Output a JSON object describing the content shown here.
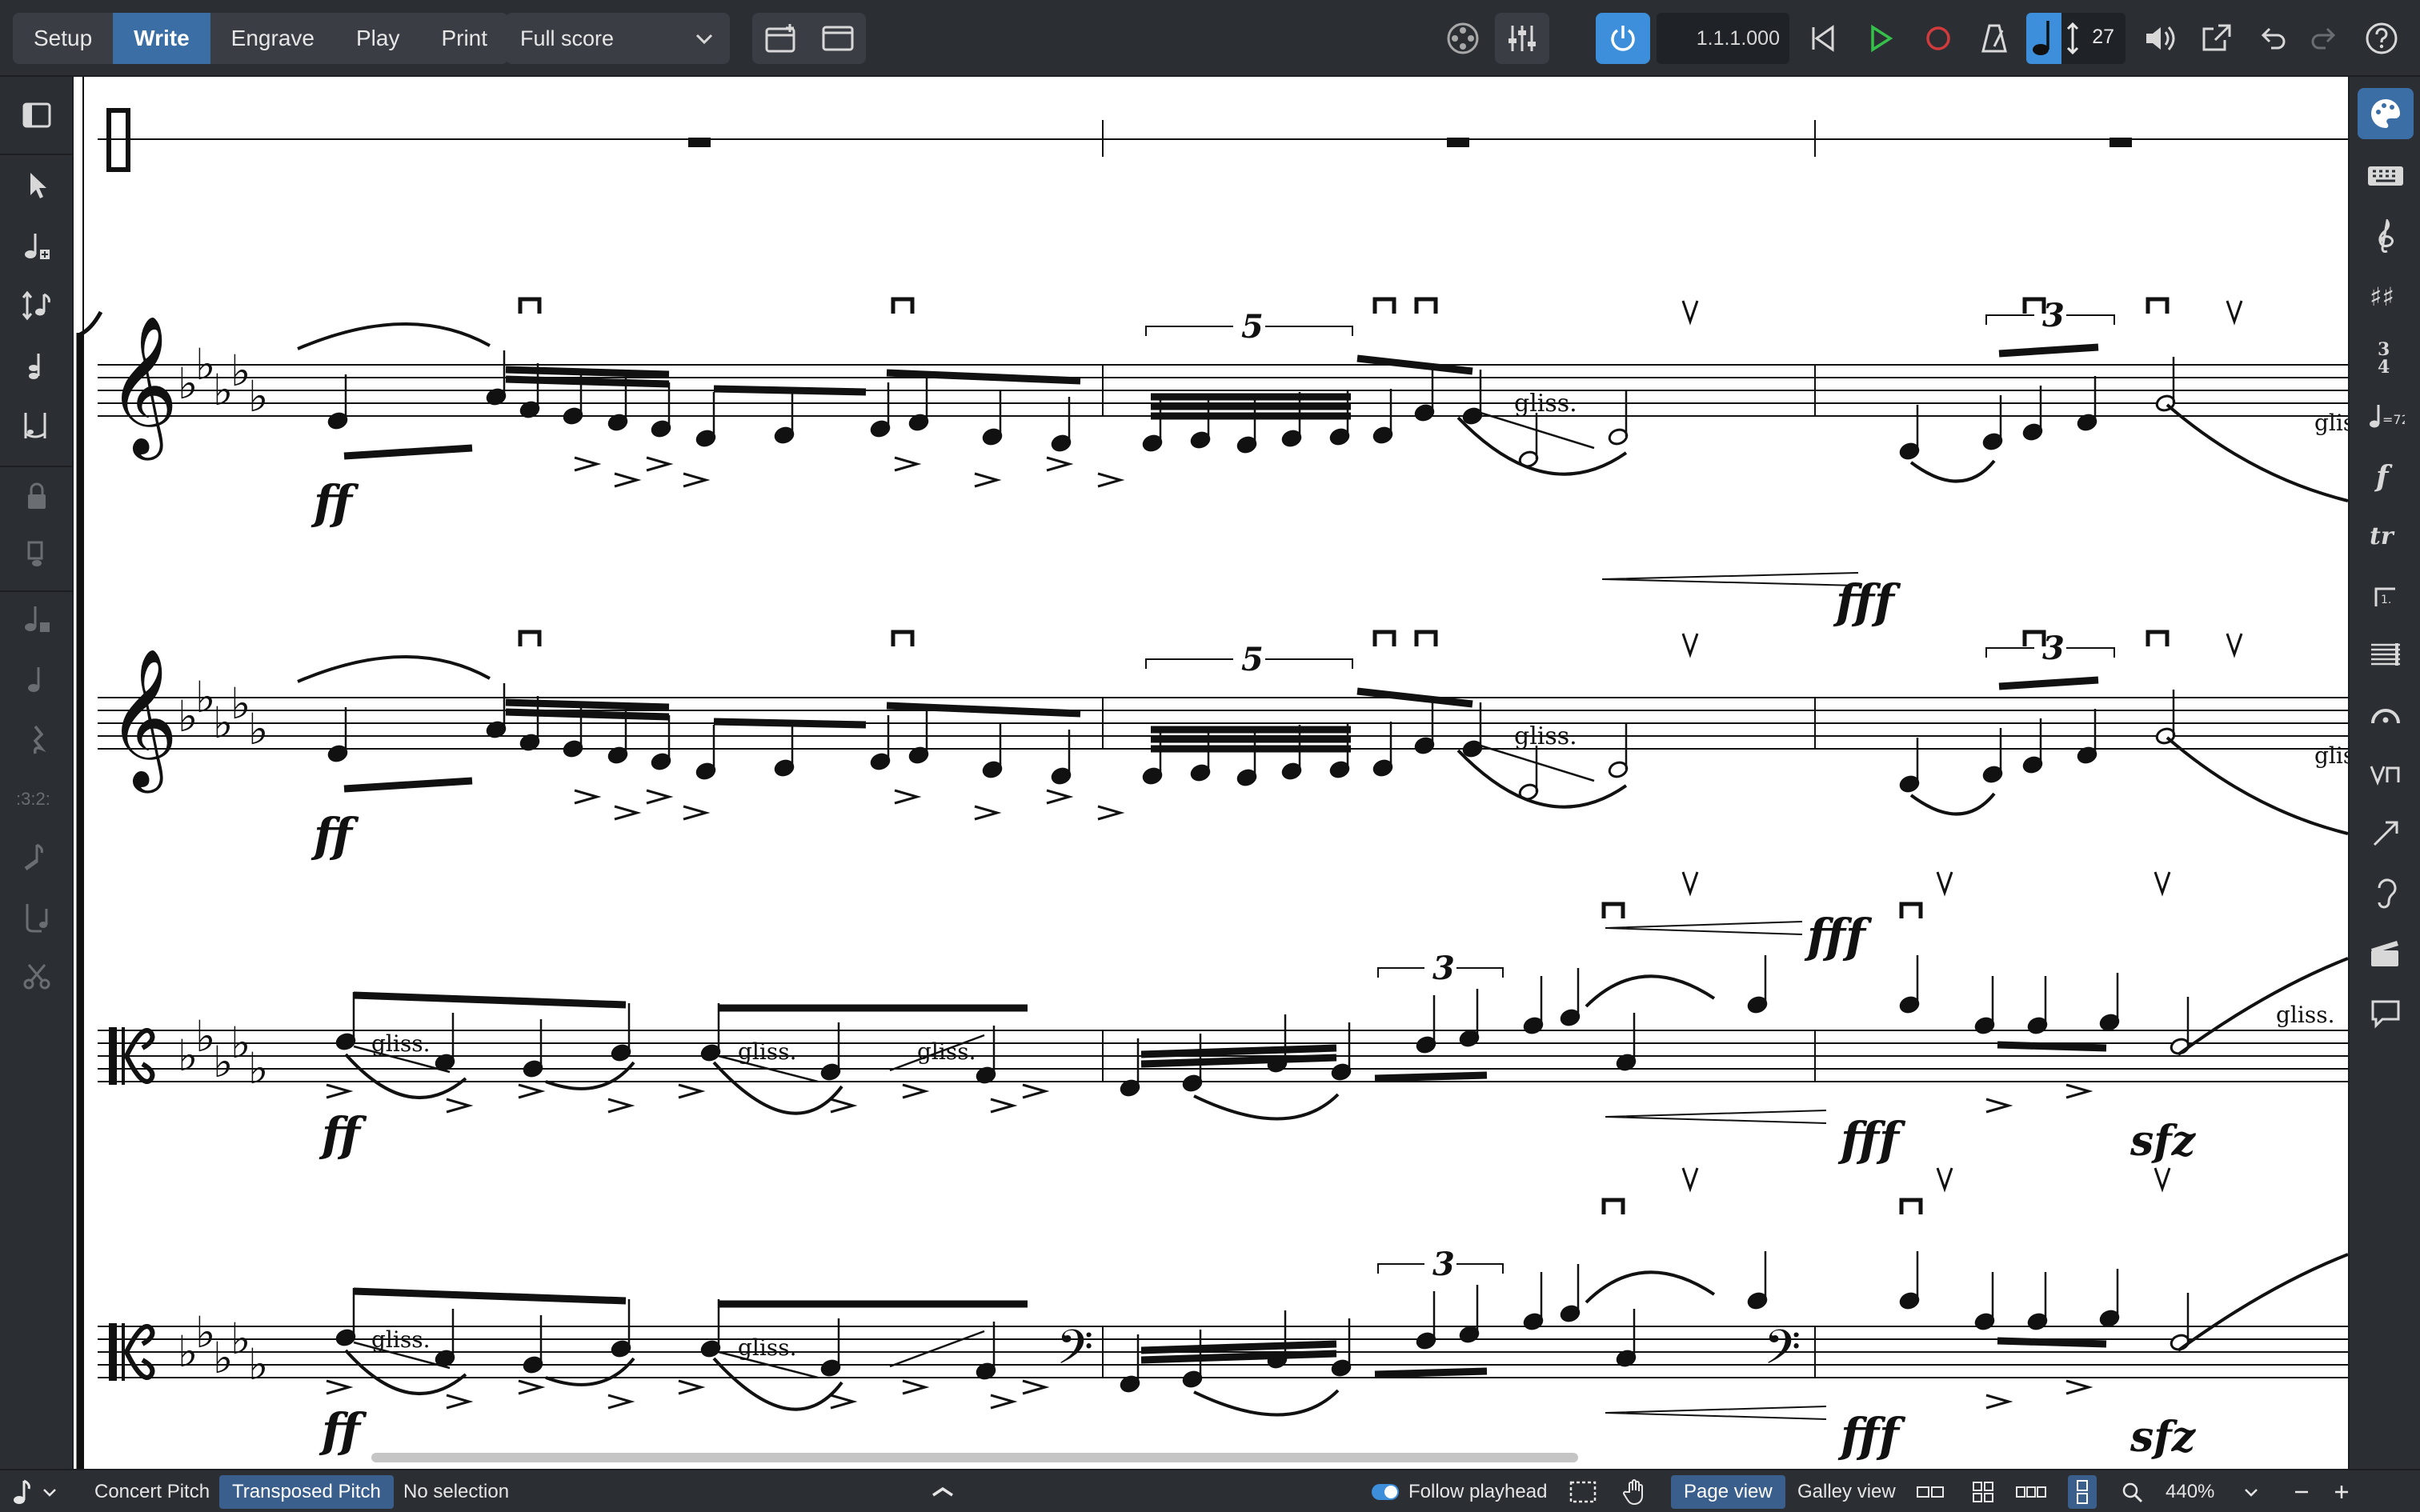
{
  "modes": [
    {
      "label": "Setup",
      "active": false
    },
    {
      "label": "Write",
      "active": true
    },
    {
      "label": "Engrave",
      "active": false
    },
    {
      "label": "Play",
      "active": false
    },
    {
      "label": "Print",
      "active": false
    }
  ],
  "layout_select": {
    "value": "Full score"
  },
  "transport": {
    "time": "1.1.1.000",
    "tempo": "27"
  },
  "score": {
    "tuplet_5": "5",
    "tuplet_3": "3",
    "gliss": "gliss.",
    "dyn_ff": "ff",
    "dyn_fff": "fff",
    "dyn_sfz": "sfz"
  },
  "status": {
    "concert_pitch": "Concert Pitch",
    "transposed_pitch": "Transposed Pitch",
    "selection": "No selection",
    "follow_playhead": "Follow playhead",
    "page_view": "Page view",
    "galley_view": "Galley view",
    "zoom": "440%"
  },
  "colors": {
    "accent": "#3b6ea5",
    "highlight": "#3d8edb",
    "play": "#35c04a",
    "record": "#d23b3b"
  }
}
